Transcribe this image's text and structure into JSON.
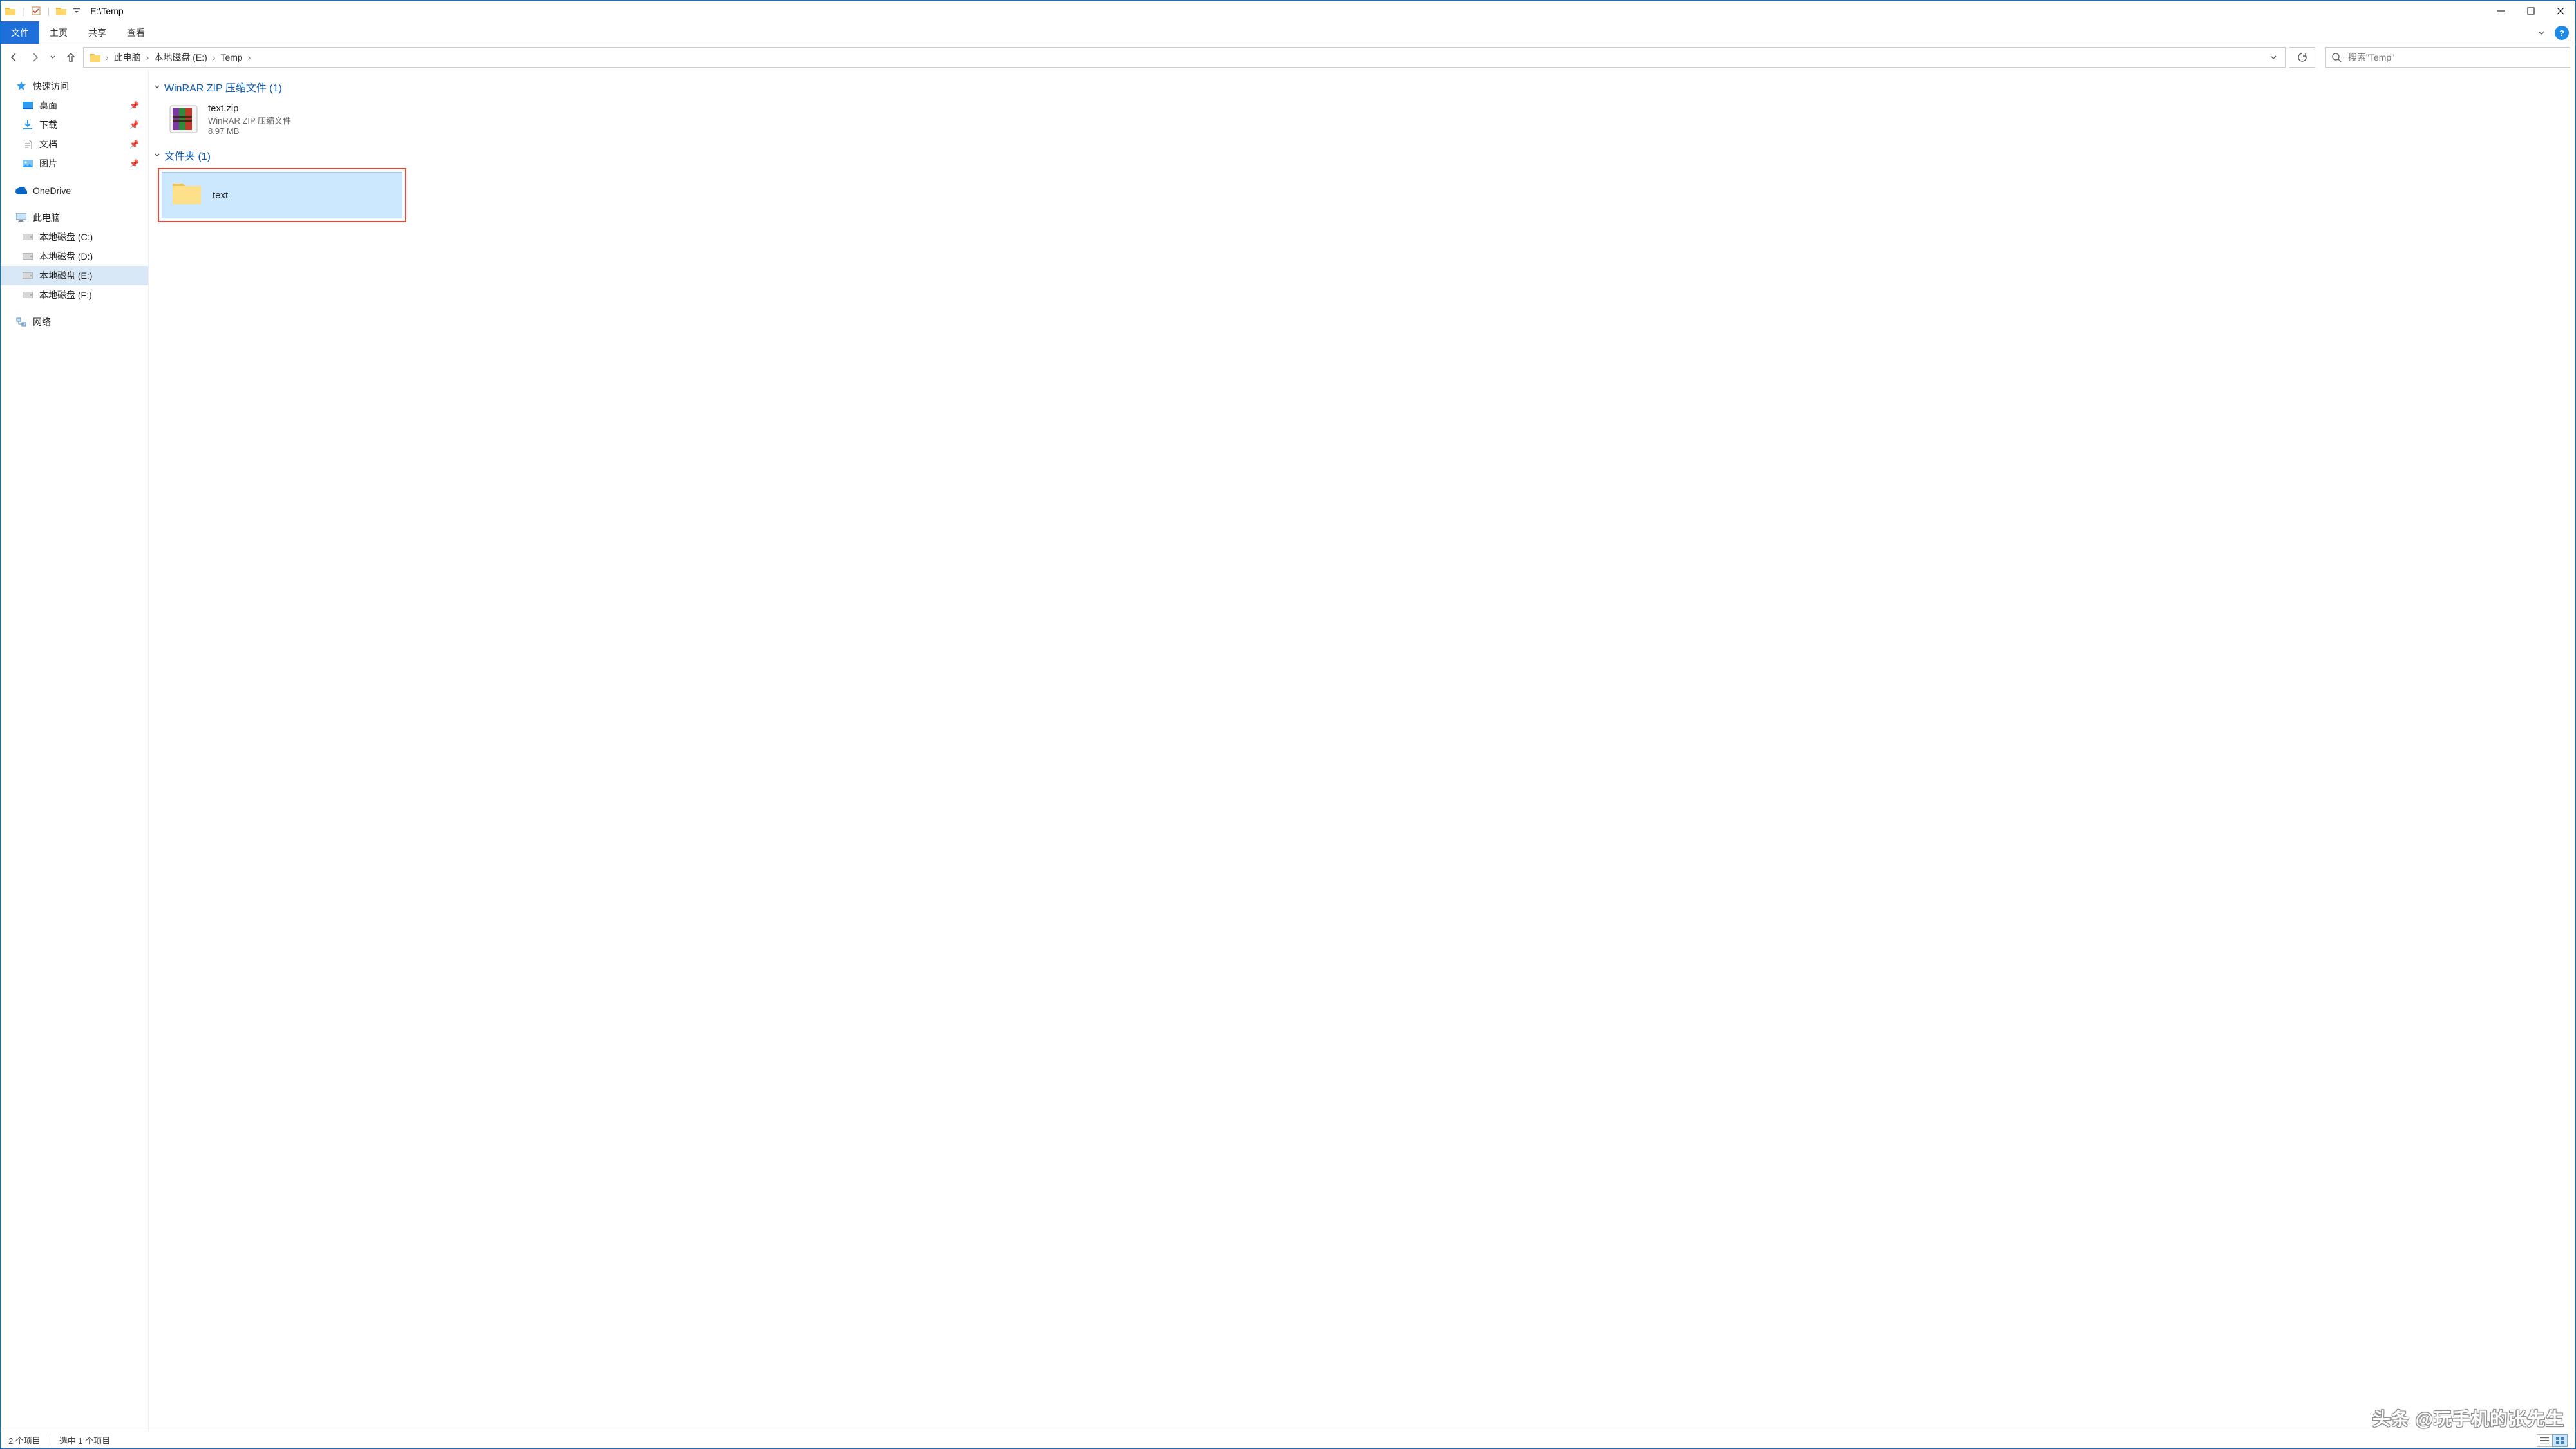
{
  "titlebar": {
    "path": "E:\\Temp"
  },
  "ribbon": {
    "file": "文件",
    "home": "主页",
    "share": "共享",
    "view": "查看"
  },
  "breadcrumbs": [
    "此电脑",
    "本地磁盘 (E:)",
    "Temp"
  ],
  "search": {
    "placeholder": "搜索\"Temp\""
  },
  "sidebar": {
    "quick_access": "快速访问",
    "desktop": "桌面",
    "downloads": "下载",
    "documents": "文档",
    "pictures": "图片",
    "onedrive": "OneDrive",
    "this_pc": "此电脑",
    "drive_c": "本地磁盘 (C:)",
    "drive_d": "本地磁盘 (D:)",
    "drive_e": "本地磁盘 (E:)",
    "drive_f": "本地磁盘 (F:)",
    "network": "网络"
  },
  "groups": {
    "zip": {
      "label": "WinRAR ZIP 压缩文件 (1)",
      "file": {
        "name": "text.zip",
        "type": "WinRAR ZIP 压缩文件",
        "size": "8.97 MB"
      }
    },
    "folder": {
      "label": "文件夹 (1)",
      "file": {
        "name": "text"
      }
    }
  },
  "status": {
    "count": "2 个项目",
    "selected": "选中 1 个项目"
  },
  "watermark": "头条 @玩手机的张先生"
}
